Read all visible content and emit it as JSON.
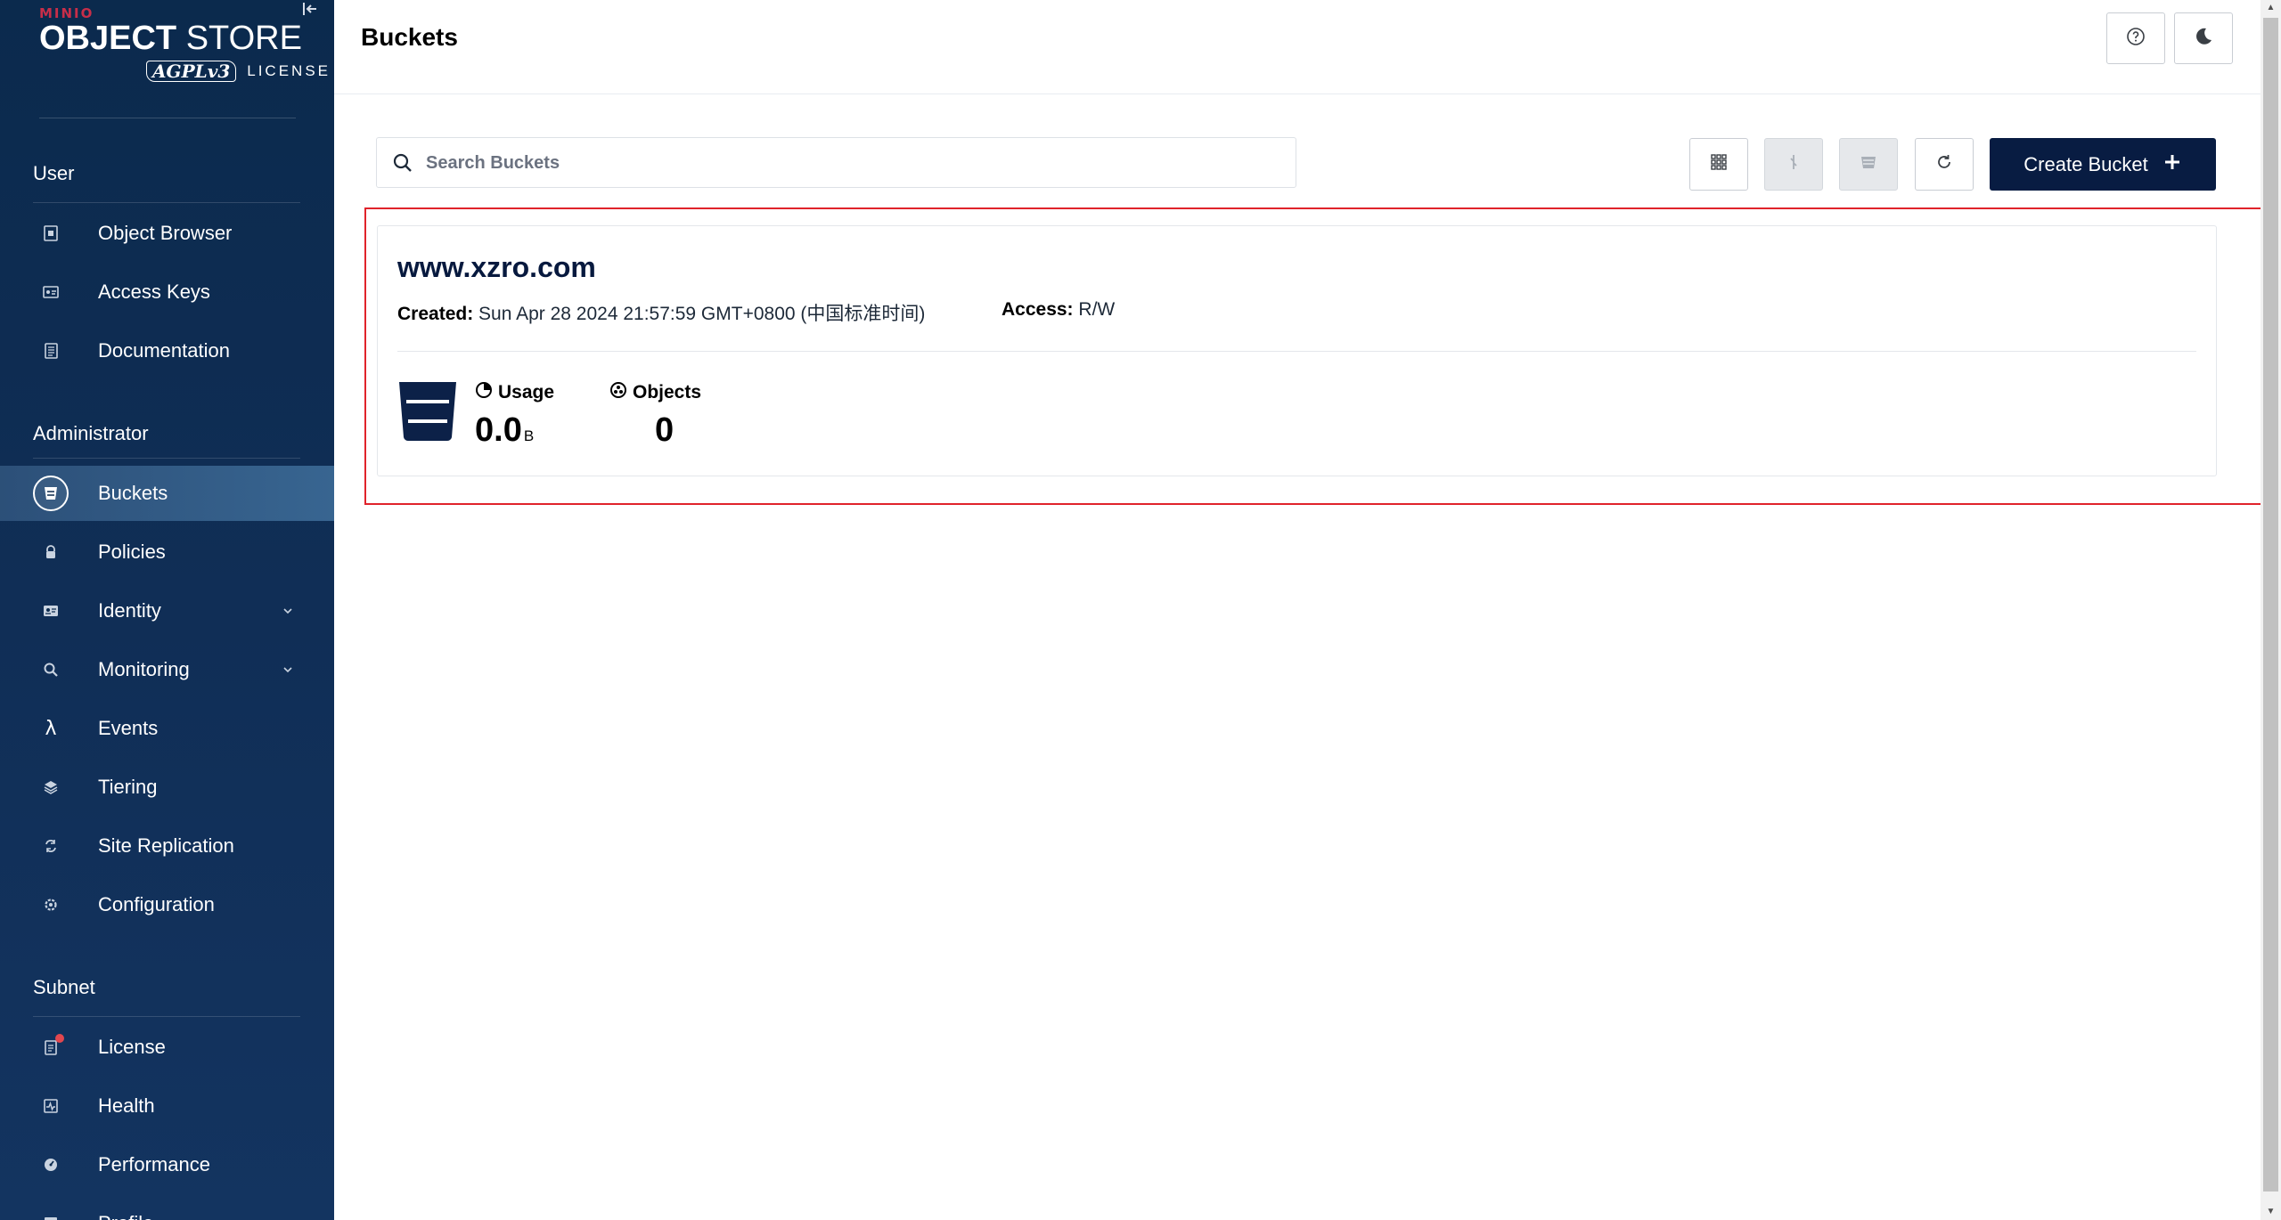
{
  "brand": {
    "vendor": "MINIO",
    "product_bold": "OBJECT",
    "product_light": " STORE",
    "license_badge": "AGPLv3",
    "license_text": "LICENSE"
  },
  "sidebar": {
    "sections": [
      {
        "title": "User",
        "items": [
          {
            "label": "Object Browser",
            "icon": "object-browser-icon"
          },
          {
            "label": "Access Keys",
            "icon": "access-keys-icon"
          },
          {
            "label": "Documentation",
            "icon": "documentation-icon"
          }
        ]
      },
      {
        "title": "Administrator",
        "items": [
          {
            "label": "Buckets",
            "icon": "bucket-icon",
            "active": true
          },
          {
            "label": "Policies",
            "icon": "lock-icon"
          },
          {
            "label": "Identity",
            "icon": "id-card-icon",
            "expandable": true
          },
          {
            "label": "Monitoring",
            "icon": "magnifier-icon",
            "expandable": true
          },
          {
            "label": "Events",
            "icon": "lambda-icon"
          },
          {
            "label": "Tiering",
            "icon": "layers-icon"
          },
          {
            "label": "Site Replication",
            "icon": "replication-icon"
          },
          {
            "label": "Configuration",
            "icon": "gear-icon"
          }
        ]
      },
      {
        "title": "Subnet",
        "items": [
          {
            "label": "License",
            "icon": "license-icon",
            "badge_dot": true
          },
          {
            "label": "Health",
            "icon": "health-icon"
          },
          {
            "label": "Performance",
            "icon": "performance-icon"
          },
          {
            "label": "Profile",
            "icon": "profile-icon"
          }
        ]
      }
    ]
  },
  "header": {
    "title": "Buckets",
    "help_icon": "question-circle-icon",
    "theme_icon": "moon-icon"
  },
  "toolbar": {
    "search_placeholder": "Search Buckets",
    "create_label": "Create Bucket",
    "select_multiple_icon": "grid-select-icon",
    "replication_icon": "replication-icon",
    "lifecycle_icon": "stack-icon",
    "refresh_icon": "refresh-icon"
  },
  "buckets": [
    {
      "name": "www.xzro.com",
      "created_label": "Created:",
      "created_value": "Sun Apr 28 2024 21:57:59 GMT+0800 (中国标准时间)",
      "access_label": "Access:",
      "access_value": "R/W",
      "usage_label": "Usage",
      "usage_value": "0.0",
      "usage_unit": "B",
      "objects_label": "Objects",
      "objects_value": "0"
    }
  ],
  "colors": {
    "sidebar_bg": "#0b2a4d",
    "primary": "#081c42",
    "highlight_border": "#e0232b",
    "brand_red": "#c72e49"
  }
}
